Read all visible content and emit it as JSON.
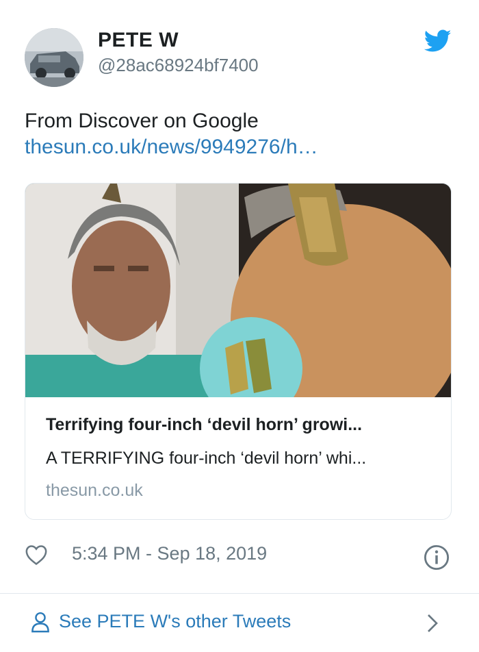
{
  "tweet": {
    "author_name": "PETE W",
    "author_handle": "@28ac68924bf7400",
    "text": "From Discover on Google",
    "link": "thesun.co.uk/news/9949276/h…",
    "timestamp": "5:34 PM - Sep 18, 2019",
    "brand_color": "#1da1f2",
    "link_color": "#2b7bb9"
  },
  "card": {
    "title": "Terrifying four-inch ‘devil horn’ growi...",
    "description": "A TERRIFYING four-inch ‘devil horn’ whi...",
    "domain": "thesun.co.uk"
  },
  "footer": {
    "label": "See PETE W's other Tweets"
  },
  "icons": [
    "twitter-bird-icon",
    "heart-icon",
    "info-icon",
    "person-icon",
    "chevron-right-icon"
  ]
}
